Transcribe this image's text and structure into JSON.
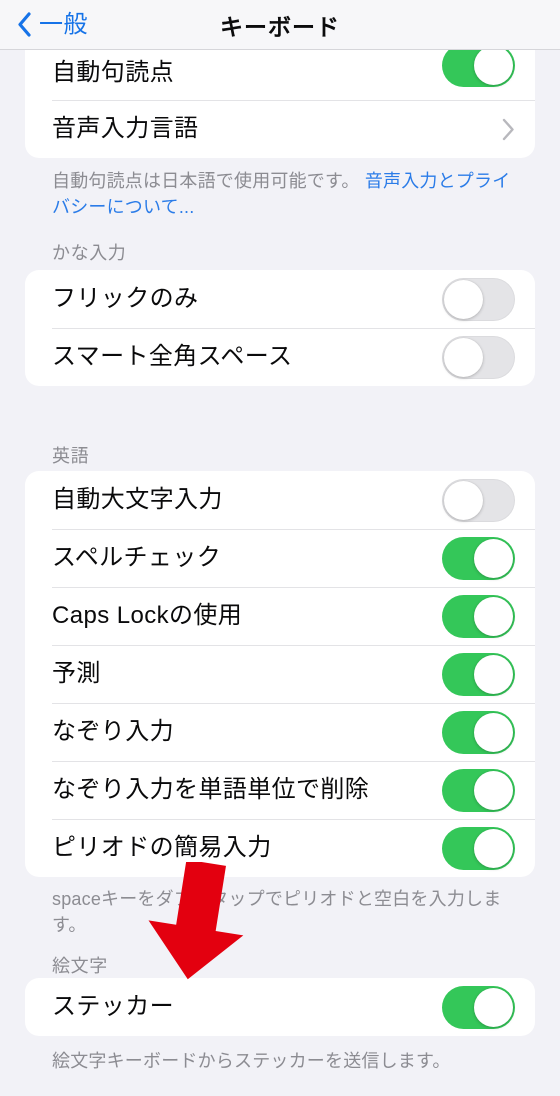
{
  "nav": {
    "back_label": "一般",
    "back_icon": "chevron-left-icon",
    "title": "キーボード"
  },
  "colors": {
    "accent_blue": "#1673e8",
    "link_blue": "#2b7ce8",
    "toggle_on_green": "#34c759",
    "toggle_off_gray": "#e4e4e7",
    "annotation_red": "#e3000f",
    "page_background": "#f2f2f7",
    "card_background": "#ffffff",
    "secondary_text": "#8c8c92"
  },
  "sections": [
    {
      "id": "dictation",
      "header": null,
      "clipped_top": true,
      "rows": [
        {
          "label": "自動句読点",
          "control": "toggle",
          "value": "on",
          "partial": true
        },
        {
          "label": "音声入力言語",
          "control": "chevron",
          "icon": "chevron-right-icon"
        }
      ],
      "footer": {
        "text": "自動句読点は日本語で使用可能です。",
        "link": "音声入力とプライバシーについて..."
      }
    },
    {
      "id": "kana-input",
      "header": "かな入力",
      "rows": [
        {
          "label": "フリックのみ",
          "control": "toggle",
          "value": "off"
        },
        {
          "label": "スマート全角スペース",
          "control": "toggle",
          "value": "off"
        }
      ],
      "footer": null
    },
    {
      "id": "english",
      "header": "英語",
      "rows": [
        {
          "label": "自動大文字入力",
          "control": "toggle",
          "value": "off"
        },
        {
          "label": "スペルチェック",
          "control": "toggle",
          "value": "on"
        },
        {
          "label": "Caps Lockの使用",
          "control": "toggle",
          "value": "on"
        },
        {
          "label": "予測",
          "control": "toggle",
          "value": "on"
        },
        {
          "label": "なぞり入力",
          "control": "toggle",
          "value": "on"
        },
        {
          "label": "なぞり入力を単語単位で削除",
          "control": "toggle",
          "value": "on"
        },
        {
          "label": "ピリオドの簡易入力",
          "control": "toggle",
          "value": "on"
        }
      ],
      "footer": {
        "text": "spaceキーをダブルタップでピリオドと空白を入力します。",
        "link": null
      }
    },
    {
      "id": "emoji",
      "header": "絵文字",
      "rows": [
        {
          "label": "ステッカー",
          "control": "toggle",
          "value": "on"
        }
      ],
      "footer": {
        "text": "絵文字キーボードからステッカーを送信します。",
        "link": null
      }
    }
  ],
  "annotation": {
    "type": "arrow",
    "icon": "red-down-arrow-icon",
    "points_to": "ステッカー",
    "color": "#e3000f"
  }
}
